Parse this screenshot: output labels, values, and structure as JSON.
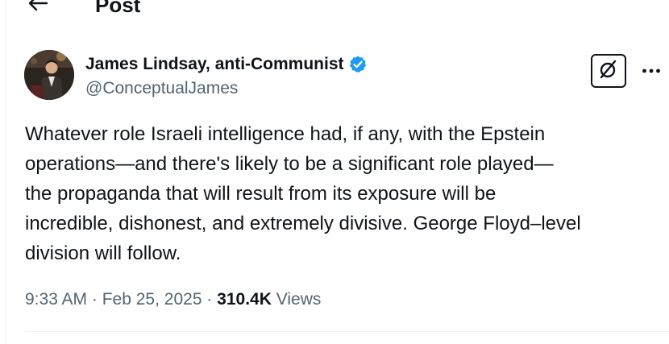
{
  "header": {
    "title": "Post",
    "back_icon": "arrow-left-icon"
  },
  "author": {
    "name": "James Lindsay, anti-Communist",
    "handle": "@ConceptualJames",
    "verified": true,
    "verified_color": "#1d9bf0"
  },
  "actions": {
    "grok_icon": "grok-icon",
    "more_icon": "more-horizontal-icon"
  },
  "tweet": {
    "lines": [
      "Whatever role Israeli intelligence had, if any, with the Epstein",
      "operations—and there's likely to be a significant role played—",
      "the propaganda that will result from its exposure will be",
      "incredible, dishonest, and extremely divisive. George Floyd–level",
      "division will follow."
    ]
  },
  "meta": {
    "time": "9:33 AM",
    "separator": " · ",
    "date": "Feb 25, 2025",
    "views_count": "310.4K",
    "views_label": "Views"
  },
  "colors": {
    "text_primary": "#0f1419",
    "text_secondary": "#536471",
    "divider": "#eff3f4"
  }
}
